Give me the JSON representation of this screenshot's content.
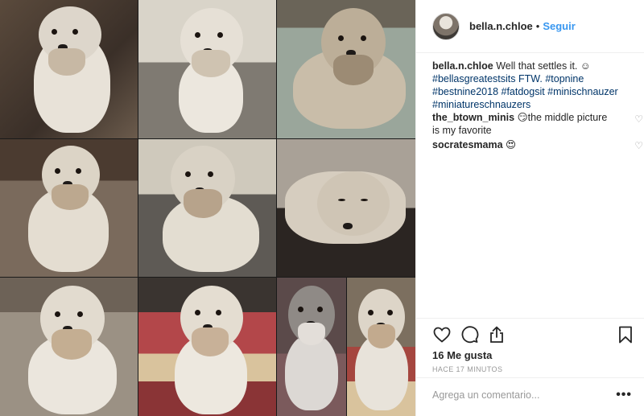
{
  "header": {
    "username": "bella.n.chloe",
    "separator": "•",
    "follow_label": "Seguir"
  },
  "caption": {
    "username": "bella.n.chloe",
    "text": "Well that settles it. ☺",
    "tags_line1": "#bellasgreatestsits FTW. #topnine",
    "tags_line2": "#bestnine2018 #fatdogsit #minischnauzer",
    "tags_line3": "#miniatureschnauzers"
  },
  "comments": [
    {
      "username": "the_btown_minis",
      "text": "😏the middle picture",
      "text2": "is my favorite"
    },
    {
      "username": "socratesmama",
      "text": "😍"
    }
  ],
  "likes": "16 Me gusta",
  "time": "HACE 17 MINUTOS",
  "add_comment_placeholder": "Agrega un comentario...",
  "more_label": "•••",
  "icons": [
    "heart-icon",
    "comment-icon",
    "share-icon",
    "bookmark-icon",
    "more-icon"
  ],
  "colors": {
    "link": "#3897f0",
    "tag": "#003569",
    "text": "#262626",
    "muted": "#999999"
  }
}
